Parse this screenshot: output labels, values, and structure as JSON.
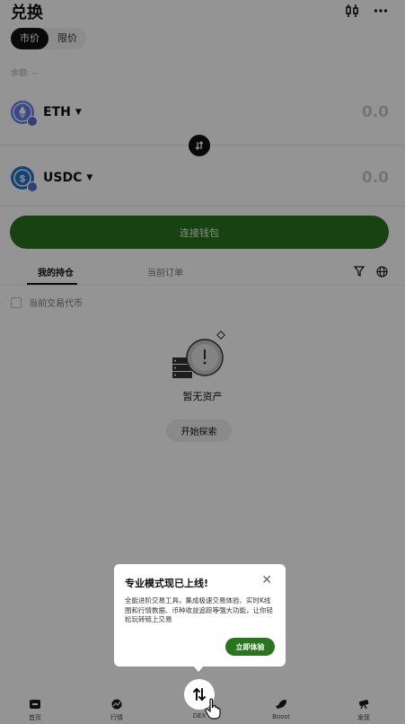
{
  "header": {
    "title": "兑换",
    "icons": [
      "candlestick-icon",
      "more-icon"
    ]
  },
  "order_type": {
    "options": [
      "市价",
      "限价"
    ],
    "selected": "市价"
  },
  "balance_label": "余额: --",
  "from_token": {
    "symbol": "ETH",
    "amount": "0.0",
    "color": "#627eea"
  },
  "to_token": {
    "symbol": "USDC",
    "amount": "0.0",
    "color": "#2775ca"
  },
  "connect_button": "连接钱包",
  "tabs": {
    "items": [
      "我的持仓",
      "当前订单"
    ],
    "active": "我的持仓"
  },
  "current_token_checkbox": "当前交易代币",
  "empty": {
    "text": "暂无资产",
    "button": "开始探索"
  },
  "tooltip": {
    "title": "专业模式现已上线!",
    "body": "全能进阶交易工具，集成极速交易体验、实时K线图和行情数据、币种收益追踪等强大功能，让你轻松玩转链上交易",
    "button": "立即体验"
  },
  "bottom_nav": [
    {
      "label": "首页",
      "icon": "home-icon"
    },
    {
      "label": "行情",
      "icon": "market-icon"
    },
    {
      "label": "DEX",
      "icon": "swap-icon"
    },
    {
      "label": "Boost",
      "icon": "rocket-icon"
    },
    {
      "label": "发现",
      "icon": "discover-icon"
    }
  ],
  "colors": {
    "accent_green": "#2c7320",
    "overlay": "rgba(0,0,0,0.42)"
  }
}
